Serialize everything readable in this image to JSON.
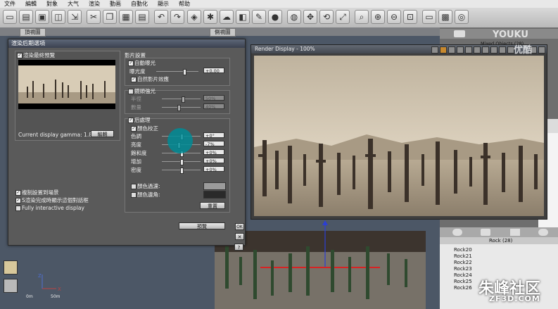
{
  "menubar": {
    "items": [
      "文件",
      "編輯",
      "對象",
      "大气",
      "渲染",
      "動画",
      "自動化",
      "顯示",
      "帮助"
    ]
  },
  "toolbar": {
    "icons": [
      "new-icon",
      "open-icon",
      "save-icon",
      "render-icon",
      "cut-icon",
      "copy-icon",
      "paste-icon",
      "delete-icon",
      "undo-icon",
      "redo-icon",
      "select-icon",
      "light-icon",
      "atmosphere-icon",
      "object-icon",
      "edit-icon",
      "palette-icon",
      "material-icon",
      "move-icon",
      "rotate-icon",
      "scale-icon",
      "zoom-icon",
      "zoom-in-icon",
      "zoom-out-icon",
      "fit-icon",
      "film-icon",
      "image-icon",
      "render-scene-icon"
    ]
  },
  "viewport": {
    "tab_top": "頂視圖",
    "tab_side": "側視圖"
  },
  "dialog": {
    "title": "渲染后期選項",
    "preview_check": "渲染最終預覽",
    "gamma": "Current display gamma: 1.80",
    "edit_btn": "編輯",
    "film": {
      "title": "影片設置",
      "auto_exposure": "自動曝光",
      "exposure_label": "曝光度",
      "exposure_value": "+0.00",
      "natural_film": "自然影片效應"
    },
    "lens": {
      "title": "鏡頭強光",
      "radius_label": "半徑",
      "radius_value": "50%",
      "amount_label": "數量",
      "amount_value": "40%"
    },
    "post": {
      "title": "后處理",
      "color_correction": "顏色校正",
      "rows": [
        {
          "label": "色調",
          "value": "+0°"
        },
        {
          "label": "亮度",
          "value": "-7%"
        },
        {
          "label": "飽和度",
          "value": "+0%"
        },
        {
          "label": "增加",
          "value": "+0%"
        },
        {
          "label": "密度",
          "value": "+0%"
        }
      ],
      "color_filter": "顏色過濾:",
      "color_vignette": "顏色邊角:",
      "reset_btn": "重置"
    },
    "copy_to_scene": "複制設置到場景",
    "show_dialog": "S渲染完成時顯示這個對話框",
    "fully_interactive": "Fully interactive display",
    "preview_btn": "預覽",
    "ok_btn": "OK",
    "cancel_btn": "✕",
    "help_btn": "?"
  },
  "render_display": {
    "title": "Render Display - 100%"
  },
  "right_panel": {
    "mixed_objects": "Mixed Objects (28)",
    "rock_group": "Rock (28)",
    "rocks": [
      "Rock20",
      "Rock21",
      "Rock22",
      "Rock23",
      "Rock24",
      "Rock25",
      "Rock26"
    ]
  },
  "status": {
    "scale_label": "0m",
    "scale_label2": "50m"
  },
  "watermarks": {
    "youku": "YOUKU",
    "youku_cn": "优酷",
    "zf": "朱峰社区",
    "zf3d": "ZF3D.COM"
  },
  "colors": {
    "accent": "#2a8f97",
    "sky": "#d4c8b4",
    "sand": "#b3a58f"
  }
}
